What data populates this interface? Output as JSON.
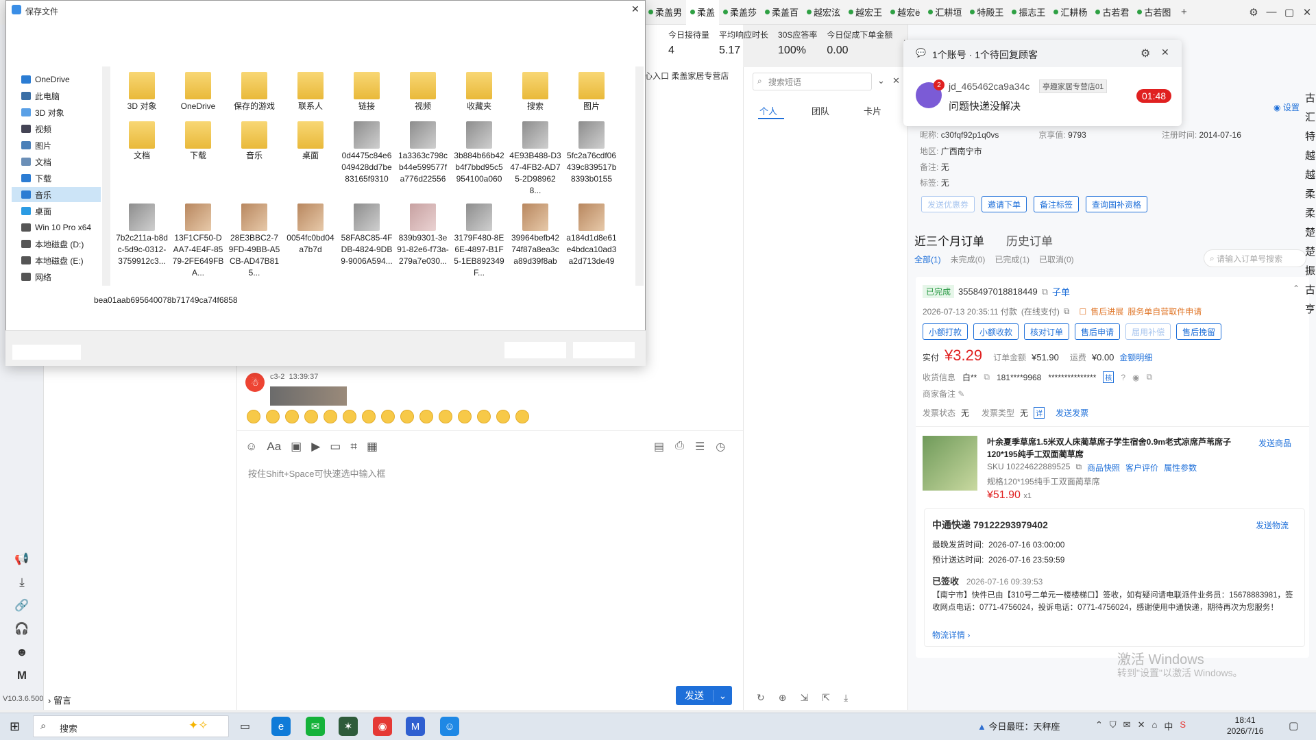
{
  "tabs": [
    {
      "label": "柔盖男",
      "active": false
    },
    {
      "label": "柔盖",
      "active": true
    },
    {
      "label": "柔盖莎",
      "active": false
    },
    {
      "label": "柔盖百",
      "active": false
    },
    {
      "label": "越宏泫",
      "active": false
    },
    {
      "label": "越宏王",
      "active": false
    },
    {
      "label": "越宏ё",
      "active": false
    },
    {
      "label": "汇耕垣",
      "active": false
    },
    {
      "label": "特殿王",
      "active": false
    },
    {
      "label": "振志王",
      "active": false
    },
    {
      "label": "汇耕杨",
      "active": false
    },
    {
      "label": "古若君",
      "active": false
    },
    {
      "label": "古若图",
      "active": false
    }
  ],
  "tab_add": "+",
  "metrics": [
    {
      "k": "今日接待量",
      "v": "4"
    },
    {
      "k": "平均响应时长",
      "v": "5.17"
    },
    {
      "k": "30S应答率",
      "v": "100%"
    },
    {
      "k": "今日促成下单金额",
      "v": "0.00"
    }
  ],
  "shop_strip": "心入口  柔盖家居专营店",
  "left_rail": {
    "version": "V10.3.6.500",
    "leave_msg": "留言"
  },
  "dialog": {
    "title": "保存文件",
    "tree": [
      {
        "label": "OneDrive",
        "color": "#2b7cd3"
      },
      {
        "label": "此电脑",
        "color": "#3a6ea5"
      },
      {
        "label": "3D 对象",
        "color": "#5aa0e6"
      },
      {
        "label": "视频",
        "color": "#445"
      },
      {
        "label": "图片",
        "color": "#4a7fb8"
      },
      {
        "label": "文档",
        "color": "#6b8fb7"
      },
      {
        "label": "下载",
        "color": "#2b7cd3"
      },
      {
        "label": "音乐",
        "color": "#2b7cd3"
      },
      {
        "label": "桌面",
        "color": "#2b9be3"
      },
      {
        "label": "Win 10 Pro x64",
        "color": "#555"
      },
      {
        "label": "本地磁盘 (D:)",
        "color": "#555"
      },
      {
        "label": "本地磁盘 (E:)",
        "color": "#555"
      },
      {
        "label": "网络",
        "color": "#555"
      }
    ],
    "files": [
      {
        "name": "3D 对象",
        "kind": "folder"
      },
      {
        "name": "OneDrive",
        "kind": "folder"
      },
      {
        "name": "保存的游戏",
        "kind": "folder"
      },
      {
        "name": "联系人",
        "kind": "folder"
      },
      {
        "name": "链接",
        "kind": "folder"
      },
      {
        "name": "视频",
        "kind": "folder"
      },
      {
        "name": "收藏夹",
        "kind": "folder"
      },
      {
        "name": "搜索",
        "kind": "folder"
      },
      {
        "name": "图片",
        "kind": "folder"
      },
      {
        "name": "文档",
        "kind": "folder"
      },
      {
        "name": "下载",
        "kind": "folder"
      },
      {
        "name": "音乐",
        "kind": "folder"
      },
      {
        "name": "桌面",
        "kind": "folder"
      },
      {
        "name": "0d4475c84e6049428dd7be83165f9310",
        "kind": "thumb"
      },
      {
        "name": "1a3363c798cb44e599577fa776d22556",
        "kind": "thumb"
      },
      {
        "name": "3b884b66b42b4f7bbd95c5954100a060",
        "kind": "thumb"
      },
      {
        "name": "4E93B488-D347-4FB2-AD75-2D989628...",
        "kind": "thumb"
      },
      {
        "name": "5fc2a76cdf06439c839517b8393b0155",
        "kind": "thumb"
      },
      {
        "name": "7b2c211a-b8dc-5d9c-0312-3759912c3...",
        "kind": "thumb"
      },
      {
        "name": "13F1CF50-DAA7-4E4F-8579-2FE649FBA...",
        "kind": "thumb warm"
      },
      {
        "name": "28E3BBC2-79FD-49BB-A5CB-AD47B815...",
        "kind": "thumb warm"
      },
      {
        "name": "0054fc0bd04a7b7d",
        "kind": "thumb warm"
      },
      {
        "name": "58FA8C85-4FDB-4824-9DB9-9006A594...",
        "kind": "thumb"
      },
      {
        "name": "839b9301-3e91-82e6-f73a-279a7e030...",
        "kind": "thumb pink"
      },
      {
        "name": "3179F480-8E6E-4897-B1F5-1EB892349F...",
        "kind": "thumb"
      },
      {
        "name": "39964befb4274f87a8ea3ca89d39f8ab",
        "kind": "thumb warm"
      },
      {
        "name": "a184d1d8e61e4bdca10ad3a2d713de49",
        "kind": "thumb warm"
      }
    ],
    "filename": "bea01aab695640078b71749ca74f6858",
    "close": "✕"
  },
  "chat": {
    "sender": "c3-2",
    "time": "13:39:37",
    "emoji_count": 15,
    "placeholder": "按住Shift+Space可快速选中输入框",
    "send": "发送"
  },
  "quick": {
    "search_placeholder": "搜索短语",
    "tabs": [
      "个人",
      "团队",
      "卡片"
    ]
  },
  "notify": {
    "title": "1个账号 · 1个待回复顾客",
    "badge": "2",
    "user": "jd_465462ca9a34c",
    "shop": "亭趣家居专营店01",
    "message": "问题快递没解决",
    "timer": "01:48"
  },
  "customer": {
    "settings": "设置",
    "nickname_label": "昵称:",
    "nickname": "c30fqf92p1q0vs",
    "jingxiang_label": "京享值:",
    "jingxiang": "9793",
    "reg_label": "注册时间:",
    "reg": "2014-07-16",
    "region_label": "地区:",
    "region": "广西南宁市",
    "remark_label": "备注:",
    "remark": "无",
    "tag_label": "标签:",
    "tag": "无",
    "actions": [
      "发送优惠券",
      "邀请下单",
      "备注标签",
      "查询国补资格"
    ]
  },
  "orders": {
    "tab_recent": "近三个月订单",
    "tab_history": "历史订单",
    "filters": [
      "全部(1)",
      "未完成(0)",
      "已完成(1)",
      "已取消(0)"
    ],
    "search_placeholder": "请输入订单号搜索",
    "status": "已完成",
    "order_id": "3558497018818449",
    "sub_order": "子单",
    "paid_time": "2026-07-13 20:35:11 付款",
    "pay_type": "(在线支付)",
    "aftersale": "售后进展",
    "aftersale_desc": "服务单自营取件申请",
    "ops": [
      "小额打款",
      "小额收款",
      "核对订单",
      "售后申请",
      "届用补偿",
      "售后挽留"
    ],
    "paid_label": "实付",
    "paid": "¥3.29",
    "total_label": "订单金额",
    "total": "¥51.90",
    "freight_label": "运费",
    "freight": "¥0.00",
    "amount_detail": "金额明细",
    "recv_label": "收货信息",
    "recv_name": "白**",
    "recv_phone": "181****9968",
    "recv_addr": "***************",
    "recv_check": "核",
    "merchant_note_label": "商家备注",
    "invoice_label": "发票状态",
    "invoice": "无",
    "invoice_type_label": "发票类型",
    "invoice_type": "无",
    "invoice_detail": "详",
    "send_invoice": "发送发票",
    "product_title": "叶余夏季草席1.5米双人床蔺草席子学生宿舍0.9m老式凉席芦苇席子 120*195纯手工双面蔺草席",
    "send_product": "发送商品",
    "sku": "SKU 10224622889525",
    "links": [
      "商品快照",
      "客户评价",
      "属性参数"
    ],
    "spec": "规格120*195纯手工双面蔺草席",
    "price": "¥51.90",
    "qty": "x1",
    "express": "中通快递 79122293979402",
    "send_logistics": "发送物流",
    "ship_time_label": "最晚发货时间:",
    "ship_time": "2026-07-16 03:00:00",
    "arrive_label": "预计送达时间:",
    "arrive": "2026-07-16 23:59:59",
    "signed": "已签收",
    "signed_time": "2026-07-16 09:39:53",
    "track": "【南宁市】快件已由【310号二单元一楼楼梯口】签收，如有疑问请电联派件业务员：15678883981，签收网点电话：0771-4756024，投诉电话：0771-4756024，感谢使用中通快递，期待再次为您服务！",
    "track_detail": "物流详情"
  },
  "windows_watermark": {
    "line1": "激活 Windows",
    "line2": "转到\"设置\"以激活 Windows。"
  },
  "taskbar": {
    "search": "搜索",
    "news": "今日最旺：天秤座",
    "time": "18:41",
    "date": "2026/7/16",
    "ime": "中"
  }
}
